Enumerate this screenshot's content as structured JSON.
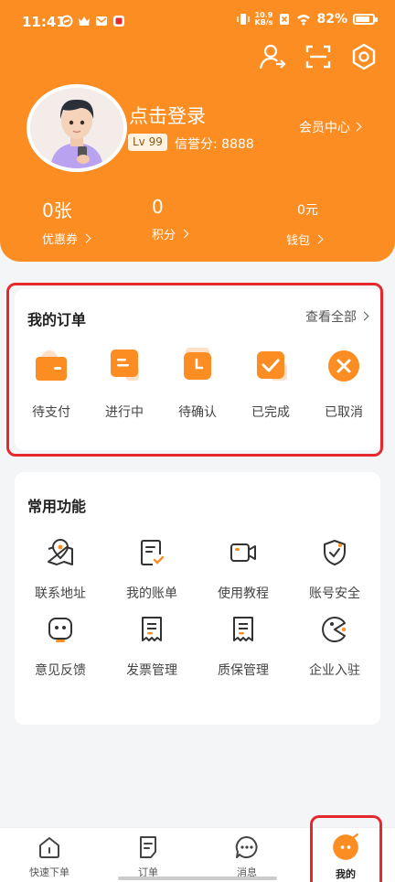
{
  "status_bar": {
    "time": "11:41",
    "speed_value": "10.9",
    "speed_unit": "KB/s",
    "battery": "82%",
    "battery_level": 0.82
  },
  "header": {
    "login_text": "点击登录",
    "level": "Lv 99",
    "credit": "信誉分: 8888",
    "member_center": "会员中心",
    "stats": [
      {
        "value": "0张",
        "label": "优惠券"
      },
      {
        "value": "0",
        "label": "积分"
      },
      {
        "value": "0元",
        "label": "钱包"
      }
    ]
  },
  "orders": {
    "title": "我的订单",
    "view_all": "查看全部",
    "items": [
      {
        "label": "待支付",
        "icon": "wallet-icon"
      },
      {
        "label": "进行中",
        "icon": "document-icon"
      },
      {
        "label": "待确认",
        "icon": "clock-icon"
      },
      {
        "label": "已完成",
        "icon": "check-icon"
      },
      {
        "label": "已取消",
        "icon": "cancel-icon"
      }
    ]
  },
  "functions": {
    "title": "常用功能",
    "items": [
      {
        "label": "联系地址",
        "icon": "map-pin-icon"
      },
      {
        "label": "我的账单",
        "icon": "bill-icon"
      },
      {
        "label": "使用教程",
        "icon": "video-icon"
      },
      {
        "label": "账号安全",
        "icon": "shield-icon"
      },
      {
        "label": "意见反馈",
        "icon": "feedback-icon"
      },
      {
        "label": "发票管理",
        "icon": "invoice-icon"
      },
      {
        "label": "质保管理",
        "icon": "warranty-icon"
      },
      {
        "label": "企业入驻",
        "icon": "enterprise-icon"
      }
    ]
  },
  "bottom_nav": [
    {
      "label": "快速下单",
      "icon": "home-icon"
    },
    {
      "label": "订单",
      "icon": "order-icon"
    },
    {
      "label": "消息",
      "icon": "message-icon"
    },
    {
      "label": "我的",
      "icon": "profile-icon",
      "active": true
    }
  ],
  "colors": {
    "accent": "#fb8d22",
    "highlight": "#e5272e",
    "background": "#f4f5f7"
  }
}
